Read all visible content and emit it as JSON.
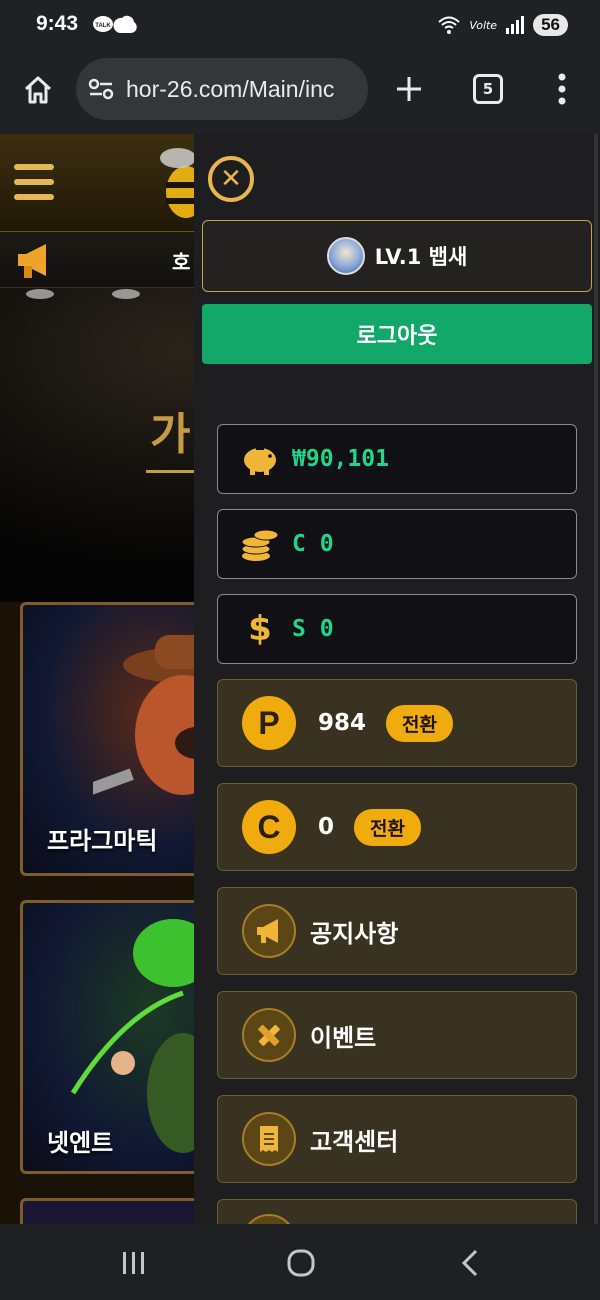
{
  "status_bar": {
    "time": "9:43",
    "talk_badge": "TALK",
    "network": "Volte",
    "battery": "56"
  },
  "browser": {
    "url": "hor-26.com/Main/inc",
    "tab_count": "5"
  },
  "site": {
    "notice_char": "호",
    "hero_text": "가입",
    "cards": [
      {
        "label": "프라그마틱"
      },
      {
        "label": "넷엔트"
      }
    ]
  },
  "drawer": {
    "level_label": "LV.1 뱁새",
    "logout_label": "로그아웃",
    "balances": [
      {
        "icon": "piggy-bank-icon",
        "value": "₩90,101"
      },
      {
        "icon": "coins-stack-icon",
        "value": "C 0"
      },
      {
        "icon": "dollar-icon",
        "value": "S 0"
      }
    ],
    "points": [
      {
        "icon": "P",
        "value": "984",
        "action": "전환"
      },
      {
        "icon": "C",
        "value": "0",
        "action": "전환"
      }
    ],
    "menu": [
      {
        "icon": "megaphone-icon",
        "label": "공지사항"
      },
      {
        "icon": "pencil-ruler-icon",
        "label": "이벤트"
      },
      {
        "icon": "receipt-icon",
        "label": "고객센터"
      }
    ]
  },
  "colors": {
    "gold": "#f0ab0f",
    "green": "#12a86a",
    "money_text": "#1fd68a"
  }
}
